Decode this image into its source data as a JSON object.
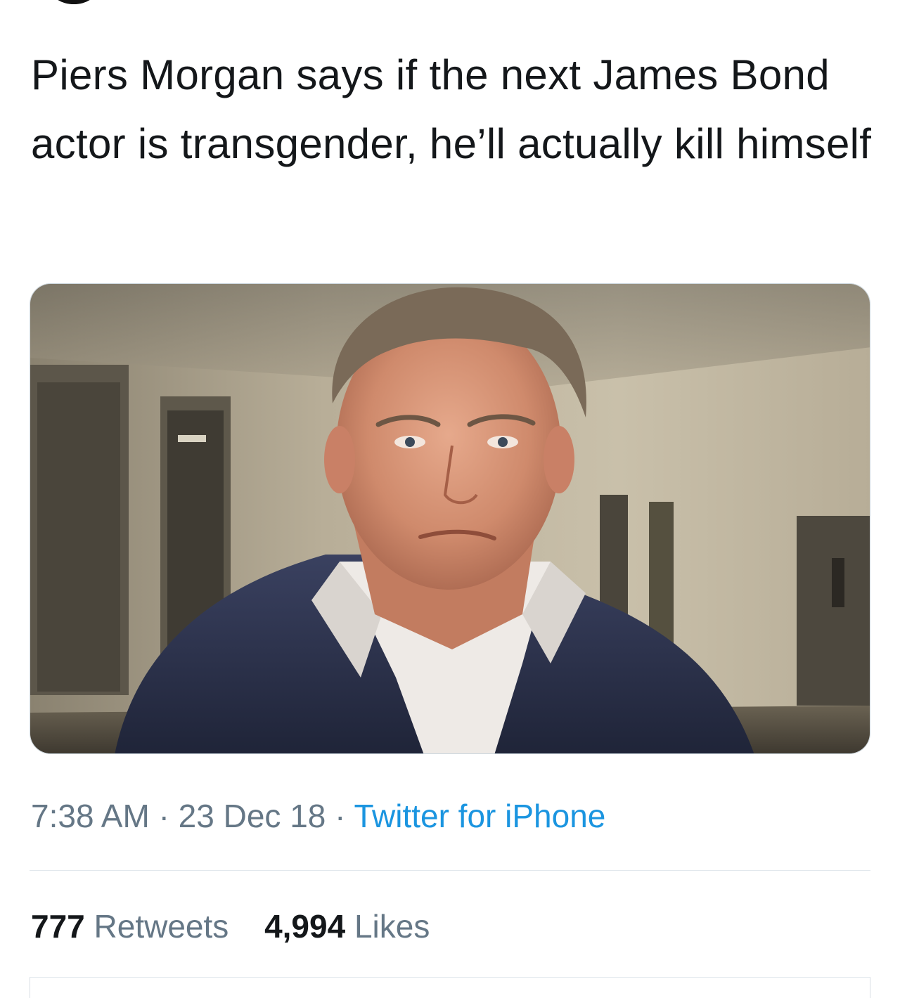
{
  "tweet": {
    "text": "Piers Morgan says if the next James Bond actor is transgender, he’ll actually kill himself",
    "timestamp_time": "7:38 AM",
    "separator": "·",
    "timestamp_date": "23 Dec 18",
    "source": "Twitter for iPhone"
  },
  "stats": {
    "retweets_count": "777",
    "retweets_label": "Retweets",
    "likes_count": "4,994",
    "likes_label": "Likes"
  },
  "colors": {
    "text": "#14171a",
    "muted": "#657786",
    "link": "#1b95e0",
    "divider": "#e1e8ed"
  },
  "media": {
    "description_icon": "photo-of-man-in-suit-in-hallway"
  }
}
